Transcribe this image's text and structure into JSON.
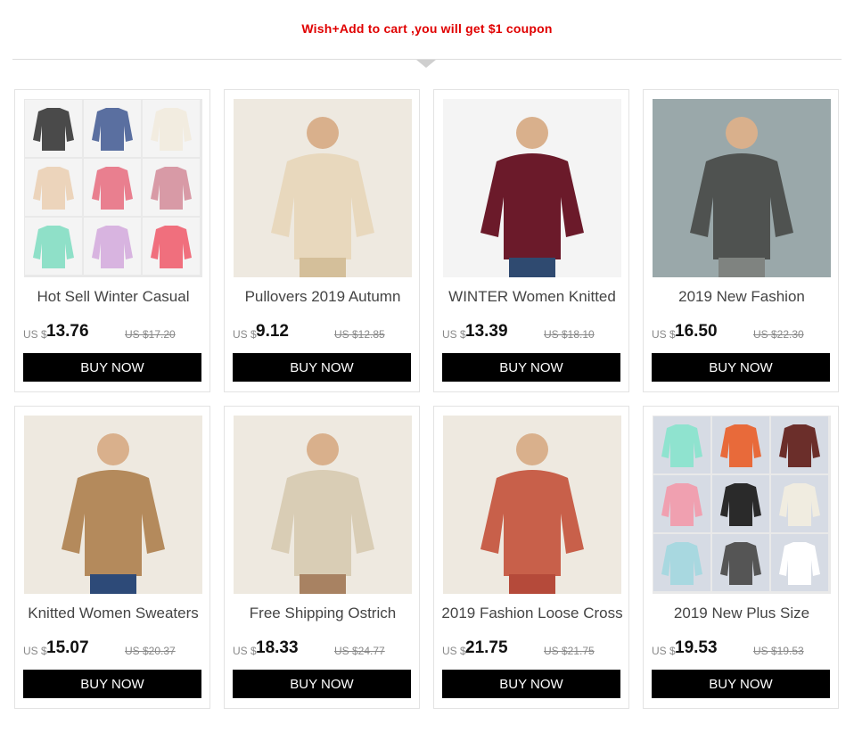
{
  "banner": {
    "text": "Wish+Add to cart ,you will get $1 coupon"
  },
  "currency_label": "US $",
  "buy_label": "BUY NOW",
  "products": [
    {
      "title": "Hot Sell Winter Casual",
      "price": "13.76",
      "old_price": "US $17.20",
      "image": "sweater-grid-photo",
      "colors": [
        "#4a4a4a",
        "#5a6fa0",
        "#f2ece0",
        "#ecd4bb",
        "#e97f8f",
        "#d89aa6",
        "#8fe0c8",
        "#d8b4e0",
        "#f06f7d"
      ]
    },
    {
      "title": "Pullovers 2019 Autumn",
      "price": "9.12",
      "old_price": "US $12.85",
      "image": "beige-fuzzy-sweater-photo",
      "colors": [
        "#e8d8bd",
        "#d4bf9a"
      ]
    },
    {
      "title": "WINTER Women Knitted",
      "price": "13.39",
      "old_price": "US $18.10",
      "image": "burgundy-sweater-photo",
      "colors": [
        "#6b1a2a",
        "#2f4a70"
      ]
    },
    {
      "title": "2019 New Fashion",
      "price": "16.50",
      "old_price": "US $22.30",
      "image": "grey-v-neck-sweater-photo",
      "colors": [
        "#4f5250",
        "#7f8380"
      ]
    },
    {
      "title": "Knitted Women Sweaters",
      "price": "15.07",
      "old_price": "US $20.37",
      "image": "camel-cardigan-photo",
      "colors": [
        "#b48a5c",
        "#2d4a78"
      ]
    },
    {
      "title": "Free Shipping Ostrich",
      "price": "18.33",
      "old_price": "US $24.77",
      "image": "fur-collar-cardigan-photo",
      "colors": [
        "#d9cdb5",
        "#a88262"
      ]
    },
    {
      "title": "2019 Fashion Loose Cross",
      "price": "21.75",
      "old_price": "US $21.75",
      "image": "lace-up-sweater-dress-photo",
      "colors": [
        "#c8604a",
        "#b54a3a"
      ]
    },
    {
      "title": "2019 New Plus Size",
      "price": "19.53",
      "old_price": "US $19.53",
      "image": "mint-v-neck-sweater-grid-photo",
      "colors": [
        "#8fe3cf",
        "#e86a3a",
        "#6b2e2a",
        "#f0a0b0",
        "#2a2a2a",
        "#f0ece0",
        "#a8d8e0",
        "#555555",
        "#ffffff"
      ]
    }
  ]
}
